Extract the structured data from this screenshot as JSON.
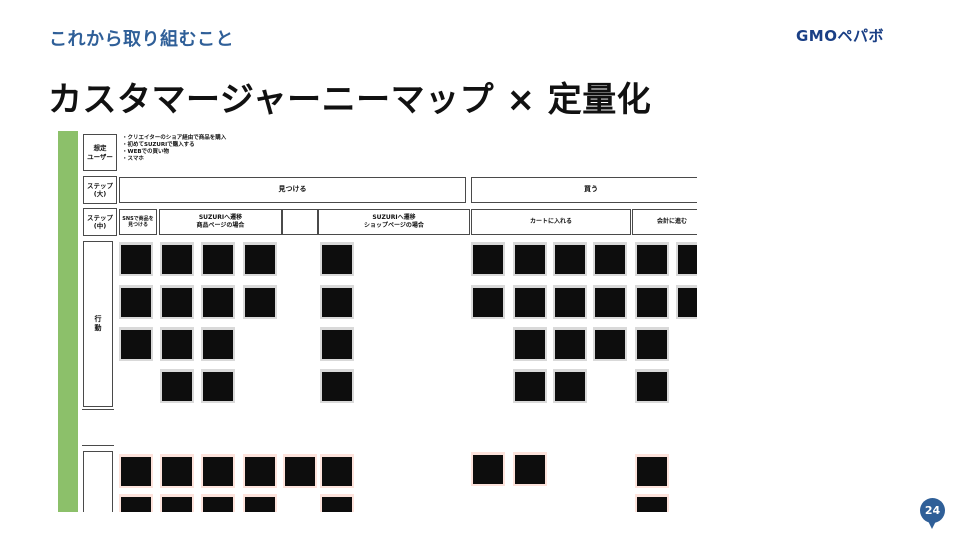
{
  "header": {
    "section_label": "これから取り組むこと",
    "logo_text": "GMOペパボ",
    "title": "カスタマージャーニーマップ × 定量化"
  },
  "map": {
    "persona_label": "想定\nユーザー",
    "persona_items": [
      "・クリエイターのショア経由で商品を購入",
      "・初めてSUZURIで購入する",
      "・WEBでの買い物",
      "・スマホ"
    ],
    "step_large_label": "ステップ\n(大)",
    "step_large": [
      "見つける",
      "買う"
    ],
    "step_mid_label": "ステップ\n(中)",
    "step_mid": [
      "SNSで商品を\n見つける",
      "SUZURIへ遷移\n商品ページの場合",
      "SUZURIへ遷移\nショップページの場合",
      "カートに入れる",
      "会計に進む"
    ],
    "action_label": "行\n動"
  },
  "page_number": "24",
  "colors": {
    "accent_blue": "#2f5f98",
    "bar_green": "#8cc06a",
    "card_gray": "#d9d9d9",
    "card_pink": "#fde3dc"
  }
}
